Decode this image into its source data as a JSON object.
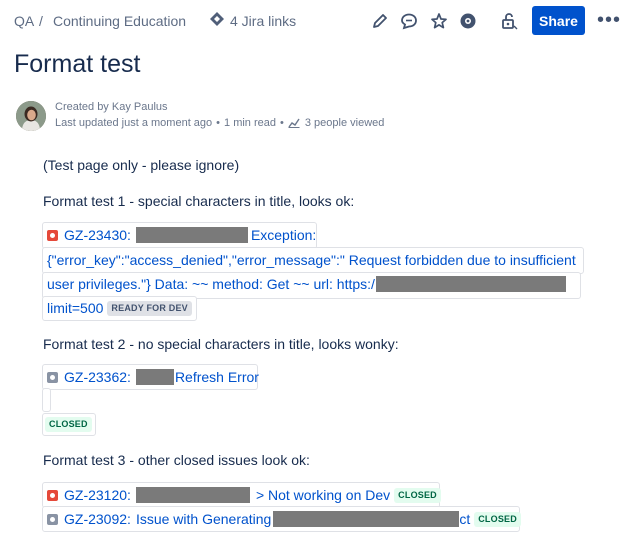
{
  "breadcrumb": {
    "space": "QA",
    "separator": "/",
    "page": "Continuing Education"
  },
  "jira_links": {
    "label": "4 Jira links"
  },
  "toolbar": {
    "edit_icon": "pencil-icon",
    "comment_icon": "comment-icon",
    "star_icon": "star-icon",
    "watch_icon": "eye-icon",
    "restrict_icon": "unlock-icon",
    "share_label": "Share",
    "more_label": "•••"
  },
  "page": {
    "title": "Format test",
    "created_by": "Created by Kay Paulus",
    "updated": "Last updated just a moment ago",
    "read_time": "1 min read",
    "viewed": "3 people viewed"
  },
  "body": {
    "intro": "(Test page only - please ignore)",
    "test1": "Format test 1 - special characters in title, looks ok:",
    "test2": "Format test 2 - no special characters in title, looks wonky:",
    "test3": "Format test 3 - other closed issues look ok:"
  },
  "issues": {
    "i1": {
      "key": "GZ-23430:",
      "line1_end": "Exception:",
      "line2": "{\"error_key\":\"access_denied\",\"error_message\":\" Request forbidden due to insufficient",
      "line3": "user privileges.\"} Data:  ~~ method: Get ~~ url: https:/",
      "line4": "limit=500",
      "status": "READY FOR DEV"
    },
    "i2": {
      "key": "GZ-23362:",
      "summary_end": "Refresh Error",
      "status": "CLOSED"
    },
    "i3": {
      "key": "GZ-23120:",
      "summary_end": "> Not working on Dev",
      "status": "CLOSED"
    },
    "i4": {
      "key": "GZ-23092:",
      "summary_start": "Issue with Generating",
      "summary_end": "ct",
      "status": "CLOSED"
    }
  },
  "colors": {
    "accent": "#0052cc",
    "link": "#0052cc",
    "bug": "#e5493a",
    "closed_green": "#006644"
  }
}
